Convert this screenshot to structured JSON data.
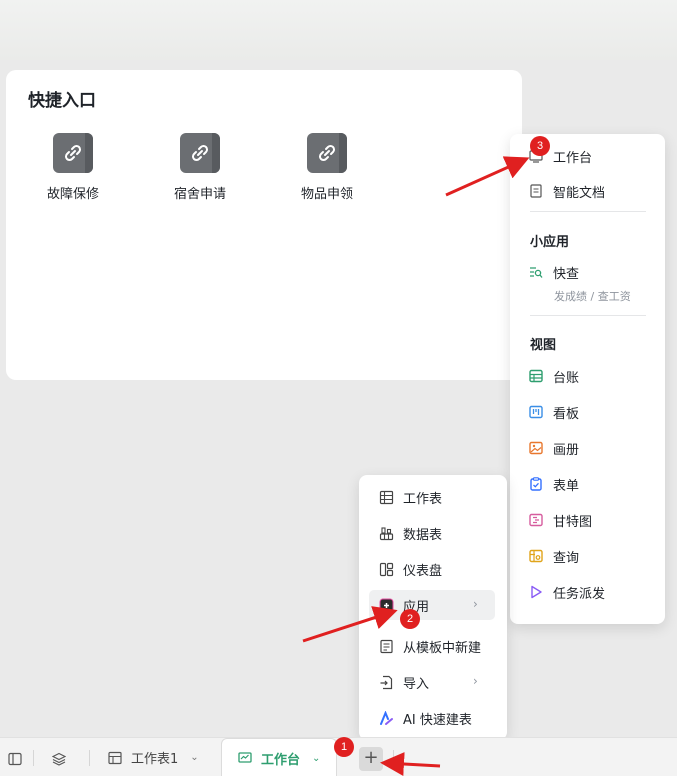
{
  "quick_entry": {
    "title": "快捷入口",
    "items": [
      {
        "label": "故障保修",
        "icon": "link-icon"
      },
      {
        "label": "宿舍申请",
        "icon": "link-icon"
      },
      {
        "label": "物品申领",
        "icon": "link-icon"
      }
    ]
  },
  "app_menu": {
    "top_items": [
      {
        "label": "工作台",
        "icon": "dashboard-icon"
      },
      {
        "label": "智能文档",
        "icon": "document-icon"
      }
    ],
    "mini_app_section": "小应用",
    "mini_app": {
      "label": "快查",
      "subtitle": "发成绩 / 查工资",
      "icon": "quick-search-icon",
      "color": "#2e9e6f"
    },
    "view_section": "视图",
    "views": [
      {
        "label": "台账",
        "icon": "grid-table-icon",
        "color": "#2e9e6f"
      },
      {
        "label": "看板",
        "icon": "kanban-icon",
        "color": "#3a8ee6"
      },
      {
        "label": "画册",
        "icon": "gallery-icon",
        "color": "#e8772e"
      },
      {
        "label": "表单",
        "icon": "form-icon",
        "color": "#3370ff"
      },
      {
        "label": "甘特图",
        "icon": "gantt-icon",
        "color": "#d65c9e"
      },
      {
        "label": "查询",
        "icon": "query-icon",
        "color": "#e0a41a"
      },
      {
        "label": "任务派发",
        "icon": "task-dispatch-icon",
        "color": "#8a5cf5"
      }
    ]
  },
  "create_menu": {
    "items": [
      {
        "label": "工作表",
        "icon": "sheet-icon"
      },
      {
        "label": "数据表",
        "icon": "datatable-icon"
      },
      {
        "label": "仪表盘",
        "icon": "dashboard-panel-icon"
      },
      {
        "label": "应用",
        "icon": "app-icon",
        "has_submenu": true
      },
      {
        "label": "从模板中新建",
        "icon": "template-icon"
      },
      {
        "label": "导入",
        "icon": "import-icon",
        "has_submenu": true
      },
      {
        "label": "AI 快速建表",
        "icon": "ai-icon"
      }
    ]
  },
  "bottom_bar": {
    "tabs": [
      {
        "label": "工作表1",
        "icon": "sheet-icon"
      },
      {
        "label": "工作台",
        "icon": "dashboard-icon",
        "active": true
      }
    ],
    "add_label": "+"
  },
  "annotations": {
    "badges": [
      "1",
      "2",
      "3"
    ]
  },
  "colors": {
    "accent_green": "#2e9e6f",
    "annotation_red": "#e02020"
  }
}
